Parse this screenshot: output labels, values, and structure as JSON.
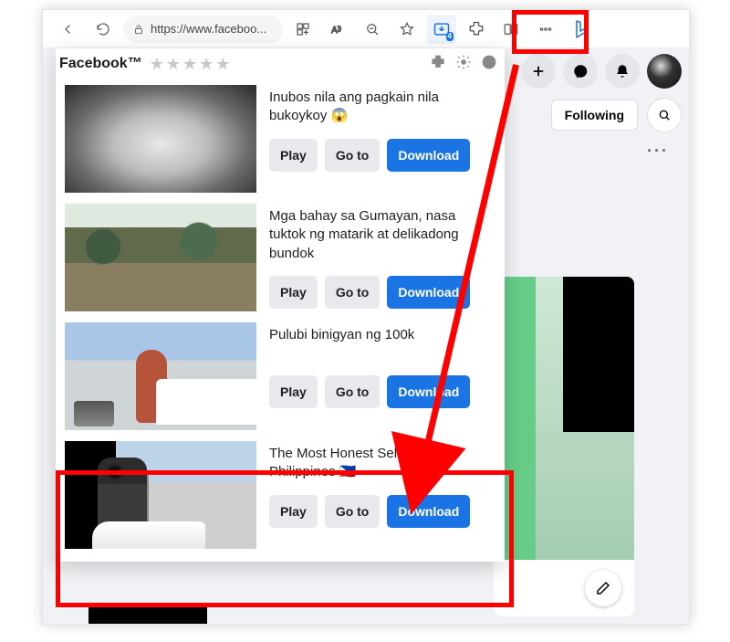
{
  "toolbar": {
    "url": "https://www.faceboo...",
    "ext_badge": "4"
  },
  "panel": {
    "title": "Facebook™",
    "play_label": "Play",
    "goto_label": "Go to",
    "download_label": "Download",
    "items": [
      {
        "title": "Inubos nila ang pagkain nila bukoykoy 😱"
      },
      {
        "title": "Mga bahay sa Gumayan, nasa tuktok ng matarik at delikadong bundok"
      },
      {
        "title": "Pulubi binigyan ng 100k"
      },
      {
        "title": "The Most Honest Seller in the Philippines 🇵🇭"
      }
    ]
  },
  "facebook": {
    "following_label": "Following"
  }
}
